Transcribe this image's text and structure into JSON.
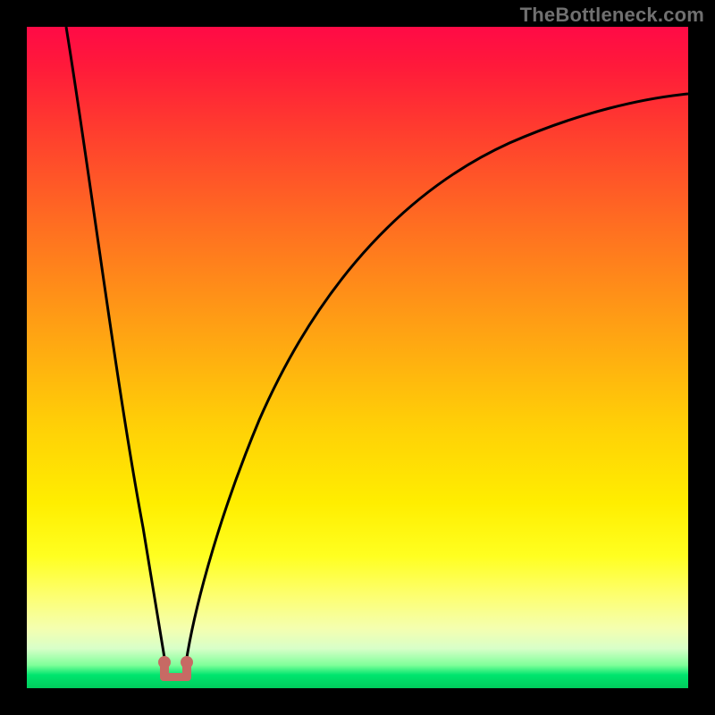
{
  "watermark": "TheBottleneck.com",
  "colors": {
    "frame": "#000000",
    "curve": "#000000",
    "marker": "#c76a64"
  },
  "chart_data": {
    "type": "line",
    "title": "",
    "xlabel": "",
    "ylabel": "",
    "xlim": [
      0,
      100
    ],
    "ylim": [
      0,
      100
    ],
    "series": [
      {
        "name": "left-branch",
        "x": [
          6,
          8,
          10,
          12,
          14,
          16,
          18,
          19.5,
          20.5,
          21
        ],
        "y": [
          100,
          85,
          70,
          55,
          40,
          27,
          15,
          7,
          3,
          1.5
        ]
      },
      {
        "name": "right-branch",
        "x": [
          24,
          25,
          27,
          30,
          34,
          40,
          48,
          58,
          70,
          84,
          100
        ],
        "y": [
          1.5,
          4,
          10,
          20,
          33,
          47,
          60,
          70,
          78,
          84,
          88
        ]
      }
    ],
    "markers": {
      "left": {
        "x": 20.3,
        "y": 2.5
      },
      "right": {
        "x": 24.5,
        "y": 2.5
      }
    },
    "gradient_stops": [
      {
        "pct": 0,
        "color": "#ff0a46"
      },
      {
        "pct": 30,
        "color": "#ff6e21"
      },
      {
        "pct": 60,
        "color": "#ffcf07"
      },
      {
        "pct": 80,
        "color": "#ffff20"
      },
      {
        "pct": 96,
        "color": "#80ff9a"
      },
      {
        "pct": 100,
        "color": "#00cc5c"
      }
    ]
  }
}
